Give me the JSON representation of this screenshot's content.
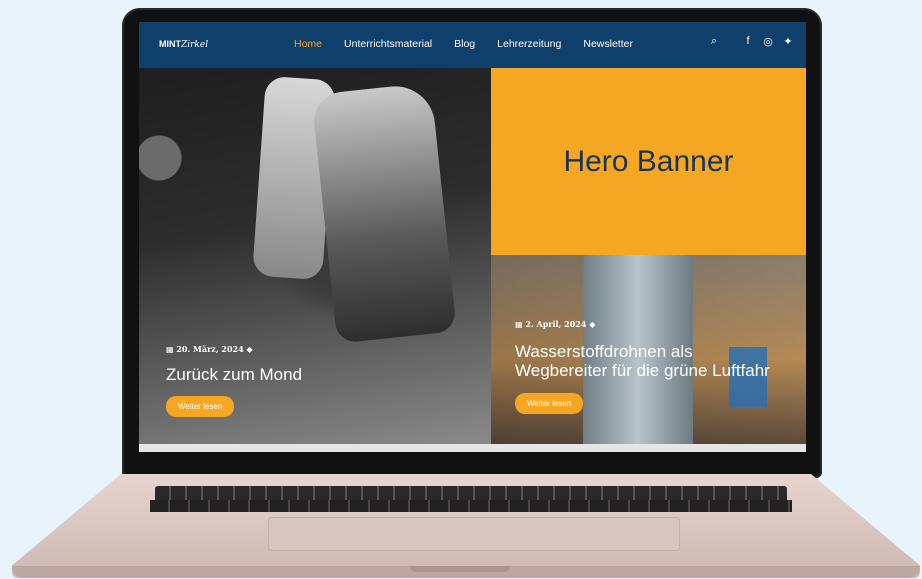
{
  "site": {
    "logo_bold": "MINT",
    "logo_italic": "Zirkel",
    "menu": [
      {
        "label": "Home",
        "active": true
      },
      {
        "label": "Unterrichtsmaterial",
        "active": false
      },
      {
        "label": "Blog",
        "active": false
      },
      {
        "label": "Lehrerzeitung",
        "active": false
      },
      {
        "label": "Newsletter",
        "active": false
      }
    ],
    "icons": [
      "search-icon",
      "facebook-icon",
      "instagram-icon",
      "twitter-icon"
    ]
  },
  "hero": {
    "banner_text": "Hero Banner",
    "left_post": {
      "date": "20. März, 2024",
      "title": "Zurück zum Mond",
      "button": "Weiter lesen"
    },
    "right_post": {
      "date": "2. April, 2024",
      "title_line1": "Wasserstoffdrohnen als",
      "title_line2": "Wegbereiter für die grüne Luftfahr",
      "button": "Weiter lesen"
    }
  },
  "colors": {
    "nav_bg": "#0f3f6b",
    "accent": "#f5a623",
    "banner_text": "#173456"
  }
}
